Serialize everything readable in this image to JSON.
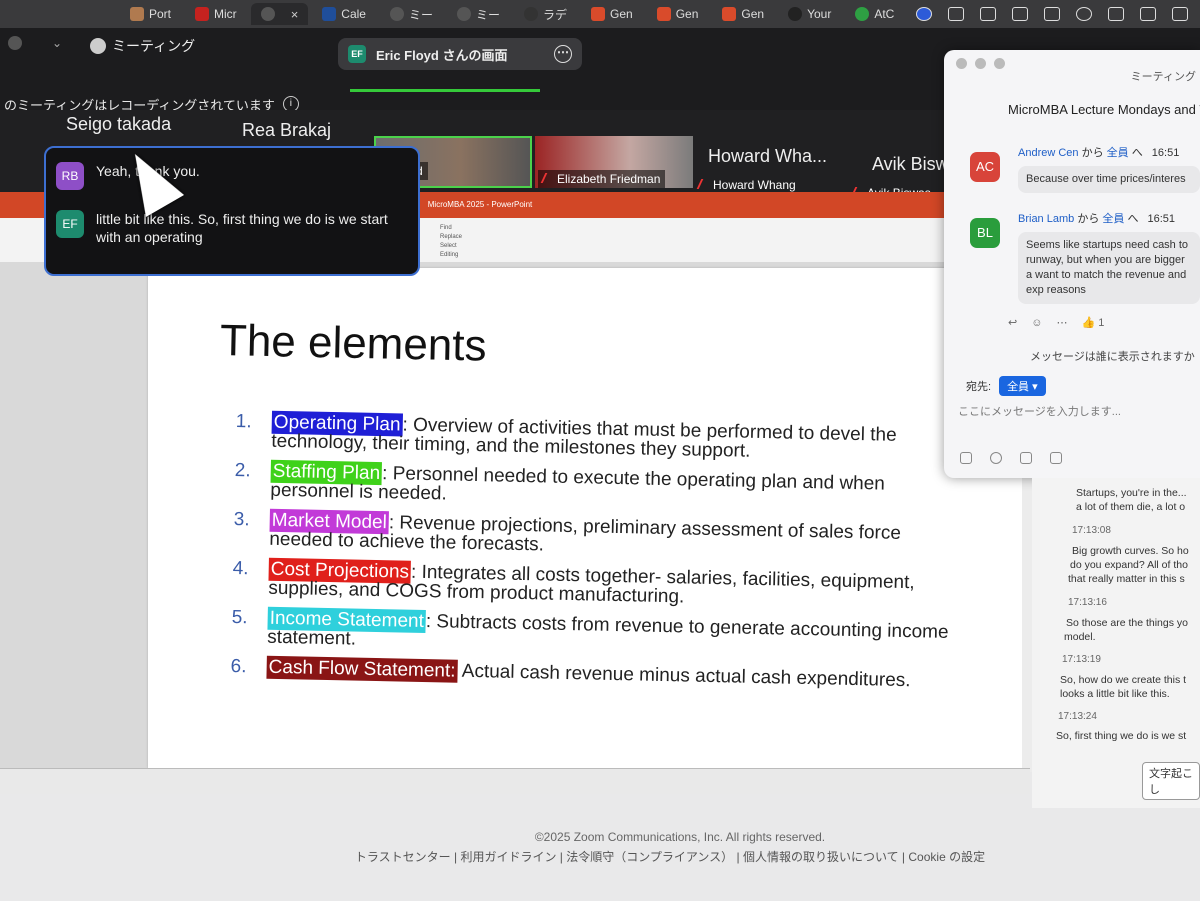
{
  "browser": {
    "tabs": [
      {
        "label": "Port",
        "fav_color": "#b07a4f"
      },
      {
        "label": "Micr",
        "fav_color": "#c5221f"
      },
      {
        "label": "",
        "fav_color": "#555",
        "active": true
      },
      {
        "label": "Cale",
        "fav_color": "#1f4e9a"
      },
      {
        "label": "ミー",
        "fav_color": "#555"
      },
      {
        "label": "ミー",
        "fav_color": "#555"
      },
      {
        "label": "ラデ",
        "fav_color": "#333"
      },
      {
        "label": "Gen",
        "fav_color": "#d94b2b"
      },
      {
        "label": "Gen",
        "fav_color": "#d94b2b"
      },
      {
        "label": "Gen",
        "fav_color": "#d94b2b"
      },
      {
        "label": "Your",
        "fav_color": "#222"
      },
      {
        "label": "AtC",
        "fav_color": "#2ea043"
      }
    ],
    "close_glyph": "×"
  },
  "zoom": {
    "meeting_label": "ミーティング",
    "screen_share_pill": "Eric Floyd さんの画面",
    "screen_share_initials": "EF",
    "recording_notice": "のミーティングはレコーディングされています",
    "participants": {
      "names": [
        "Seigo takada",
        "Rea Brakaj",
        "Howard Wha...",
        "Avik Biswa"
      ],
      "tiles": [
        "yd",
        "Elizabeth Friedman",
        "Howard Whang",
        "Avik Biswas"
      ]
    }
  },
  "chat_popup": {
    "messages": [
      {
        "initials": "RB",
        "color": "#8e4fc7",
        "text": "Yeah, thank you."
      },
      {
        "initials": "EF",
        "color": "#1d8b6e",
        "text": "little bit like this. So, first thing we do is we start with an operating"
      }
    ]
  },
  "ppt": {
    "window_title": "MicroMBA 2025 - PowerPoint",
    "tools": [
      "Find",
      "Replace",
      "Select",
      "Editing"
    ],
    "slide_title": "The elements",
    "items": [
      {
        "num": "1.",
        "term": "Operating Plan",
        "color": "#1f1fd6",
        "rest": ": Overview of activities that must be performed to devel the technology, their timing, and the milestones they support."
      },
      {
        "num": "2.",
        "term": "Staffing Plan",
        "color": "#3fd21a",
        "rest": ": Personnel needed to execute the operating plan and when personnel is needed."
      },
      {
        "num": "3.",
        "term": "Market Model",
        "color": "#c23ad8",
        "rest": ": Revenue projections, preliminary assessment of sales force needed to achieve the forecasts."
      },
      {
        "num": "4.",
        "term": "Cost Projections",
        "color": "#e0201b",
        "rest": ": Integrates all costs together- salaries, facilities, equipment, supplies, and COGS from product manufacturing."
      },
      {
        "num": "5.",
        "term": "Income Statement",
        "color": "#2fd0dc",
        "rest": ": Subtracts costs from revenue to generate accounting income statement."
      },
      {
        "num": "6.",
        "term": "Cash Flow Statement:",
        "color": "#8a1515",
        "rest": " Actual cash revenue minus actual cash expenditures."
      }
    ]
  },
  "chat_panel": {
    "title": "ミーティング",
    "meeting_name": "MicroMBA Lecture Mondays and W",
    "messages": [
      {
        "initials": "AC",
        "color": "#d8443a",
        "sender": "Andrew Cen",
        "to_prefix": "から",
        "to": "全員",
        "to_suffix": "へ",
        "time": "16:51",
        "text": "Because over time prices/interes"
      },
      {
        "initials": "BL",
        "color": "#2a9d3c",
        "sender": "Brian Lamb",
        "to_prefix": "から",
        "to": "全員",
        "to_suffix": "へ",
        "time": "16:51",
        "text": "Seems like startups need cash to runway, but when you are bigger a want to match the revenue and exp reasons"
      }
    ],
    "reaction_count": "1",
    "visibility_notice": "メッセージは誰に表示されますか",
    "to_label": "宛先:",
    "to_value": "全員",
    "input_placeholder": "ここにメッセージを入力します..."
  },
  "transcript": {
    "lines": [
      "Startups, you're in the...",
      "a lot of them die, a lot o"
    ],
    "entries": [
      {
        "time": "17:13:08",
        "lines": [
          "Big growth curves. So ho",
          "do you expand? All of tho",
          "that really matter in this s"
        ]
      },
      {
        "time": "17:13:16",
        "lines": [
          "So those are the things yo",
          "model."
        ]
      },
      {
        "time": "17:13:19",
        "lines": [
          "So, how do we create this t",
          "looks a little bit like this."
        ]
      },
      {
        "time": "17:13:24",
        "lines": [
          "So, first thing we do is we st"
        ]
      }
    ],
    "button": "文字起こし"
  },
  "footer": {
    "copyright": "©2025 Zoom Communications, Inc. All rights reserved.",
    "links": "トラストセンター | 利用ガイドライン | 法令順守（コンプライアンス） | 個人情報の取り扱いについて | Cookie の設定"
  }
}
